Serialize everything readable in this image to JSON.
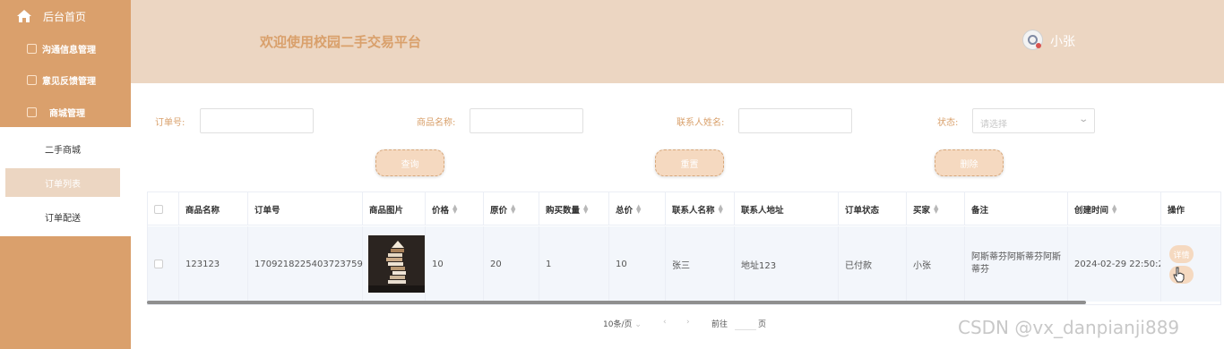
{
  "sidebar": {
    "home_label": "后台首页",
    "groups": [
      {
        "label": "沟通信息管理"
      },
      {
        "label": "意见反馈管理"
      },
      {
        "label": "商城管理"
      }
    ],
    "sub_items": [
      {
        "label": "二手商城"
      },
      {
        "label": "订单列表"
      },
      {
        "label": "订单配送"
      }
    ]
  },
  "header": {
    "welcome": "欢迎使用校园二手交易平台",
    "username": "小张"
  },
  "filters": {
    "order_no_label": "订单号:",
    "product_name_label": "商品名称:",
    "contact_name_label": "联系人姓名:",
    "status_label": "状态:",
    "status_placeholder": "请选择"
  },
  "buttons": {
    "search": "查询",
    "reset": "重置",
    "delete": "删除"
  },
  "table": {
    "columns": [
      "商品名称",
      "订单号",
      "商品图片",
      "价格",
      "原价",
      "购买数量",
      "总价",
      "联系人名称",
      "联系人地址",
      "订单状态",
      "买家",
      "备注",
      "创建时间",
      "操作"
    ],
    "rows": [
      {
        "product_name": "123123",
        "order_no": "1709218225403723759",
        "price": "10",
        "original_price": "20",
        "quantity": "1",
        "total": "10",
        "contact_name": "张三",
        "contact_address": "地址123",
        "status": "已付款",
        "buyer": "小张",
        "remark": "阿斯蒂芬阿斯蒂芬阿斯蒂芬",
        "created": "2024-02-29 22:50:24",
        "detail_label": "详情"
      }
    ]
  },
  "pagination": {
    "page_size": "10条/页",
    "goto": "前往",
    "page_unit": "页"
  },
  "watermark": "CSDN @vx_danpianji889",
  "colors": {
    "sidebar": "#daa06c",
    "header": "#ecd6c2",
    "accent": "#d9a06b",
    "button": "#f5d9c0"
  }
}
